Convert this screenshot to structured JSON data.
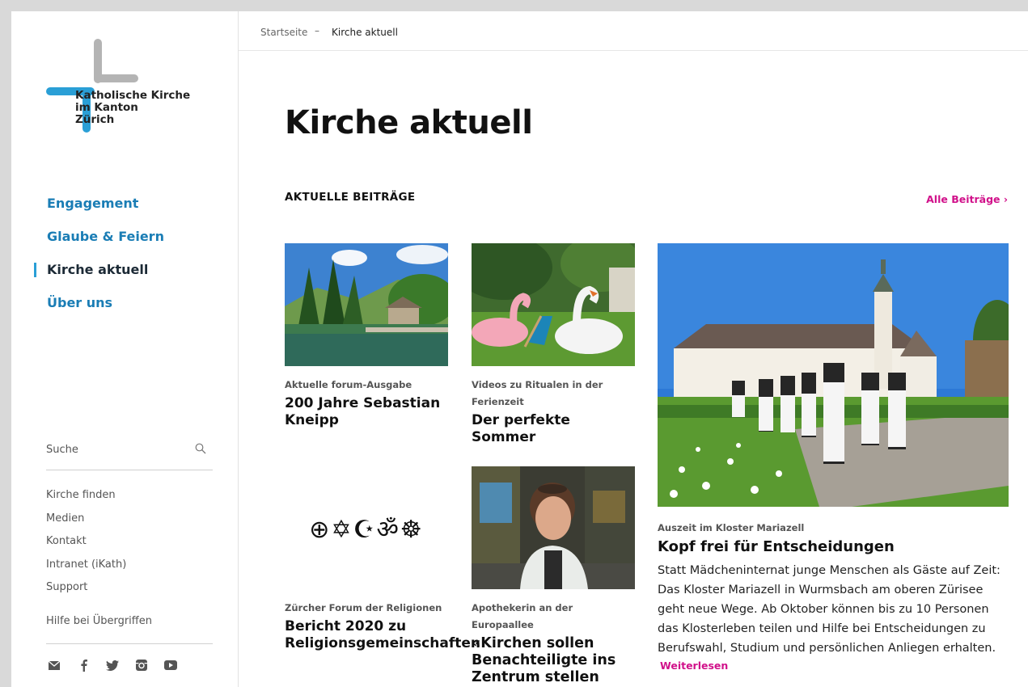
{
  "logo": {
    "line1": "Katholische Kirche",
    "line2": "im Kanton",
    "line3": "Zürich",
    "gray": "#b4b4b4",
    "blue": "#2a9fd6"
  },
  "nav": [
    {
      "label": "Engagement"
    },
    {
      "label": "Glaube & Feiern"
    },
    {
      "label": "Kirche aktuell"
    },
    {
      "label": "Über uns"
    }
  ],
  "search": {
    "label": "Suche"
  },
  "links": [
    "Kirche finden",
    "Medien",
    "Kontakt",
    "Intranet (iKath)",
    "Support",
    "Hilfe bei Übergriffen"
  ],
  "social_icons": [
    "mail-icon",
    "facebook-icon",
    "twitter-icon",
    "instagram-icon",
    "youtube-icon"
  ],
  "breadcrumb": {
    "home": "Startseite",
    "separator": "–",
    "current": "Kirche aktuell"
  },
  "page": {
    "title": "Kirche aktuell",
    "section": "AKTUELLE BEITRÄGE",
    "all_link": "Alle Beiträge ›"
  },
  "colors": {
    "accent": "#d1118a",
    "nav": "#1a7db5"
  },
  "cards": [
    {
      "kicker": "Aktuelle forum-Ausgabe",
      "title": "200 Jahre Sebastian Kneipp"
    },
    {
      "kicker": "Videos zu Ritualen in der Ferienzeit",
      "title": "Der perfekte Sommer"
    },
    {
      "kicker": "Auszeit im Kloster Mariazell",
      "title": "Kopf frei für Entscheidungen",
      "teaser": "Statt Mädcheninternat junge Menschen als Gäste auf Zeit: Das Kloster Mariazell in Wurmsbach am oberen Zürisee geht neue Wege. Ab Oktober können bis zu 10 Personen das Klosterleben teilen und Hilfe bei Entscheidungen zu Berufswahl, Studium und persönlichen Anliegen erhalten.",
      "more": "Weiterlesen"
    },
    {
      "kicker": "Zürcher Forum der Religionen",
      "title": "Bericht 2020 zu Religionsgemeinschaften",
      "symbols": "⊕✡☪ॐ☸"
    },
    {
      "kicker": "Apothekerin an der Europaallee",
      "title": "«Kirchen sollen Benachteiligte ins Zentrum stellen"
    }
  ]
}
